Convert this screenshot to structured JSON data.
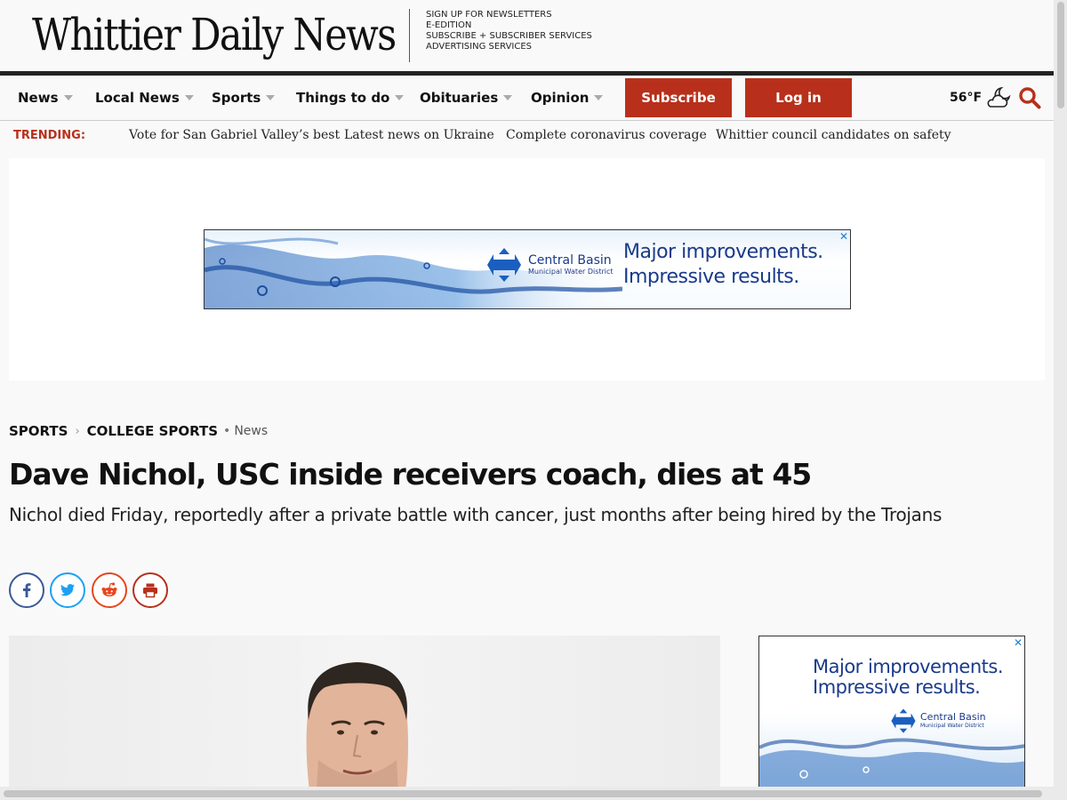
{
  "masthead": {
    "logo": "Whittier Daily News",
    "links": [
      "SIGN UP FOR NEWSLETTERS",
      "E-EDITION",
      "SUBSCRIBE + SUBSCRIBER SERVICES",
      "ADVERTISING SERVICES"
    ]
  },
  "nav": {
    "items": [
      "News",
      "Local News",
      "Sports",
      "Things to do",
      "Obituaries",
      "Opinion"
    ],
    "subscribe_label": "Subscribe",
    "login_label": "Log in",
    "weather": "56°F",
    "weather_icon": "partly-cloudy-night-icon",
    "search_icon": "search-icon"
  },
  "trending": {
    "label": "TRENDING:",
    "links": [
      "Vote for San Gabriel Valley’s best",
      "Latest news on Ukraine",
      "Complete coronavirus coverage",
      "Whittier council candidates on safety"
    ]
  },
  "ads": {
    "close_glyph": "✕",
    "line1": "Major improvements.",
    "line2": "Impressive results.",
    "brand": "Central Basin",
    "brand_sub": "Municipal Water District"
  },
  "article": {
    "breadcrumb": [
      "SPORTS",
      "COLLEGE SPORTS"
    ],
    "section_tag": "News",
    "headline": "Dave Nichol, USC inside receivers coach, dies at 45",
    "dek": "Nichol died Friday, reportedly after a private battle with cancer, just months after being hired by the Trojans",
    "share": [
      "facebook-icon",
      "twitter-icon",
      "reddit-icon",
      "print-icon"
    ]
  },
  "colors": {
    "brand_red": "#b8301b",
    "facebook": "#3b5998",
    "twitter": "#1da1f2",
    "reddit": "#e6461e",
    "print": "#b8301b",
    "ad_blue": "#1a3a8a"
  }
}
